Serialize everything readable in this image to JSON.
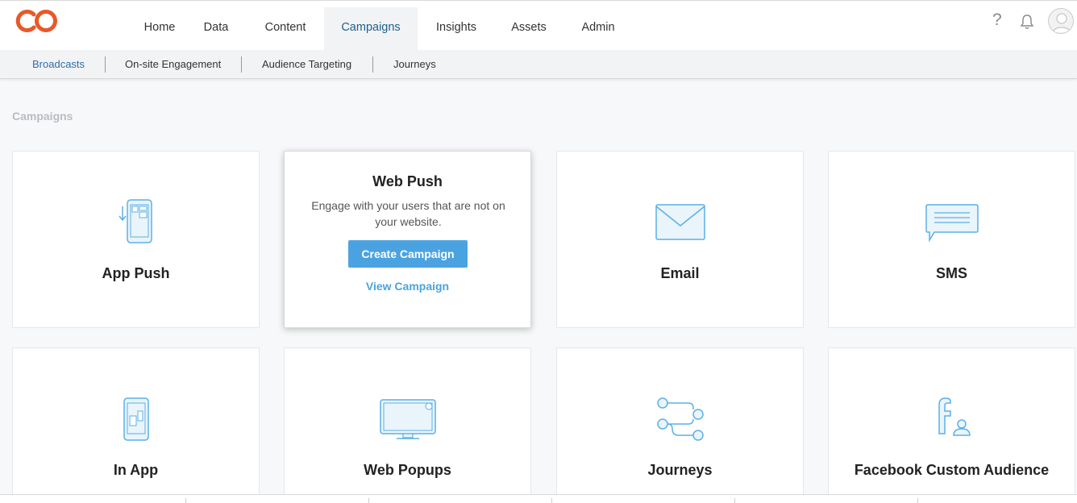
{
  "nav": {
    "items": [
      {
        "label": "Home"
      },
      {
        "label": "Data"
      },
      {
        "label": "Content"
      },
      {
        "label": "Campaigns",
        "active": true
      },
      {
        "label": "Insights"
      },
      {
        "label": "Assets"
      },
      {
        "label": "Admin"
      }
    ],
    "help_label": "?"
  },
  "subnav": {
    "items": [
      {
        "label": "Broadcasts",
        "active": true
      },
      {
        "label": "On-site Engagement"
      },
      {
        "label": "Audience Targeting"
      },
      {
        "label": "Journeys"
      }
    ]
  },
  "page": {
    "section_title": "Campaigns"
  },
  "cards": [
    {
      "label": "App Push",
      "icon": "mobile-push-icon"
    },
    {
      "label": "Web Push",
      "icon": "web-push-icon",
      "hovered": true,
      "description": "Engage with your users that are not on your website.",
      "create_label": "Create Campaign",
      "view_label": "View Campaign"
    },
    {
      "label": "Email",
      "icon": "envelope-icon"
    },
    {
      "label": "SMS",
      "icon": "sms-bubble-icon"
    },
    {
      "label": "In App",
      "icon": "in-app-icon"
    },
    {
      "label": "Web Popups",
      "icon": "monitor-popup-icon"
    },
    {
      "label": "Journeys",
      "icon": "journey-flow-icon"
    },
    {
      "label": "Facebook Custom Audience",
      "icon": "facebook-audience-icon"
    }
  ],
  "colors": {
    "brand": "#e8582a",
    "accent": "#4aa3e0",
    "icon_stroke": "#5bb0e6",
    "icon_fill": "#eaf4fb"
  }
}
